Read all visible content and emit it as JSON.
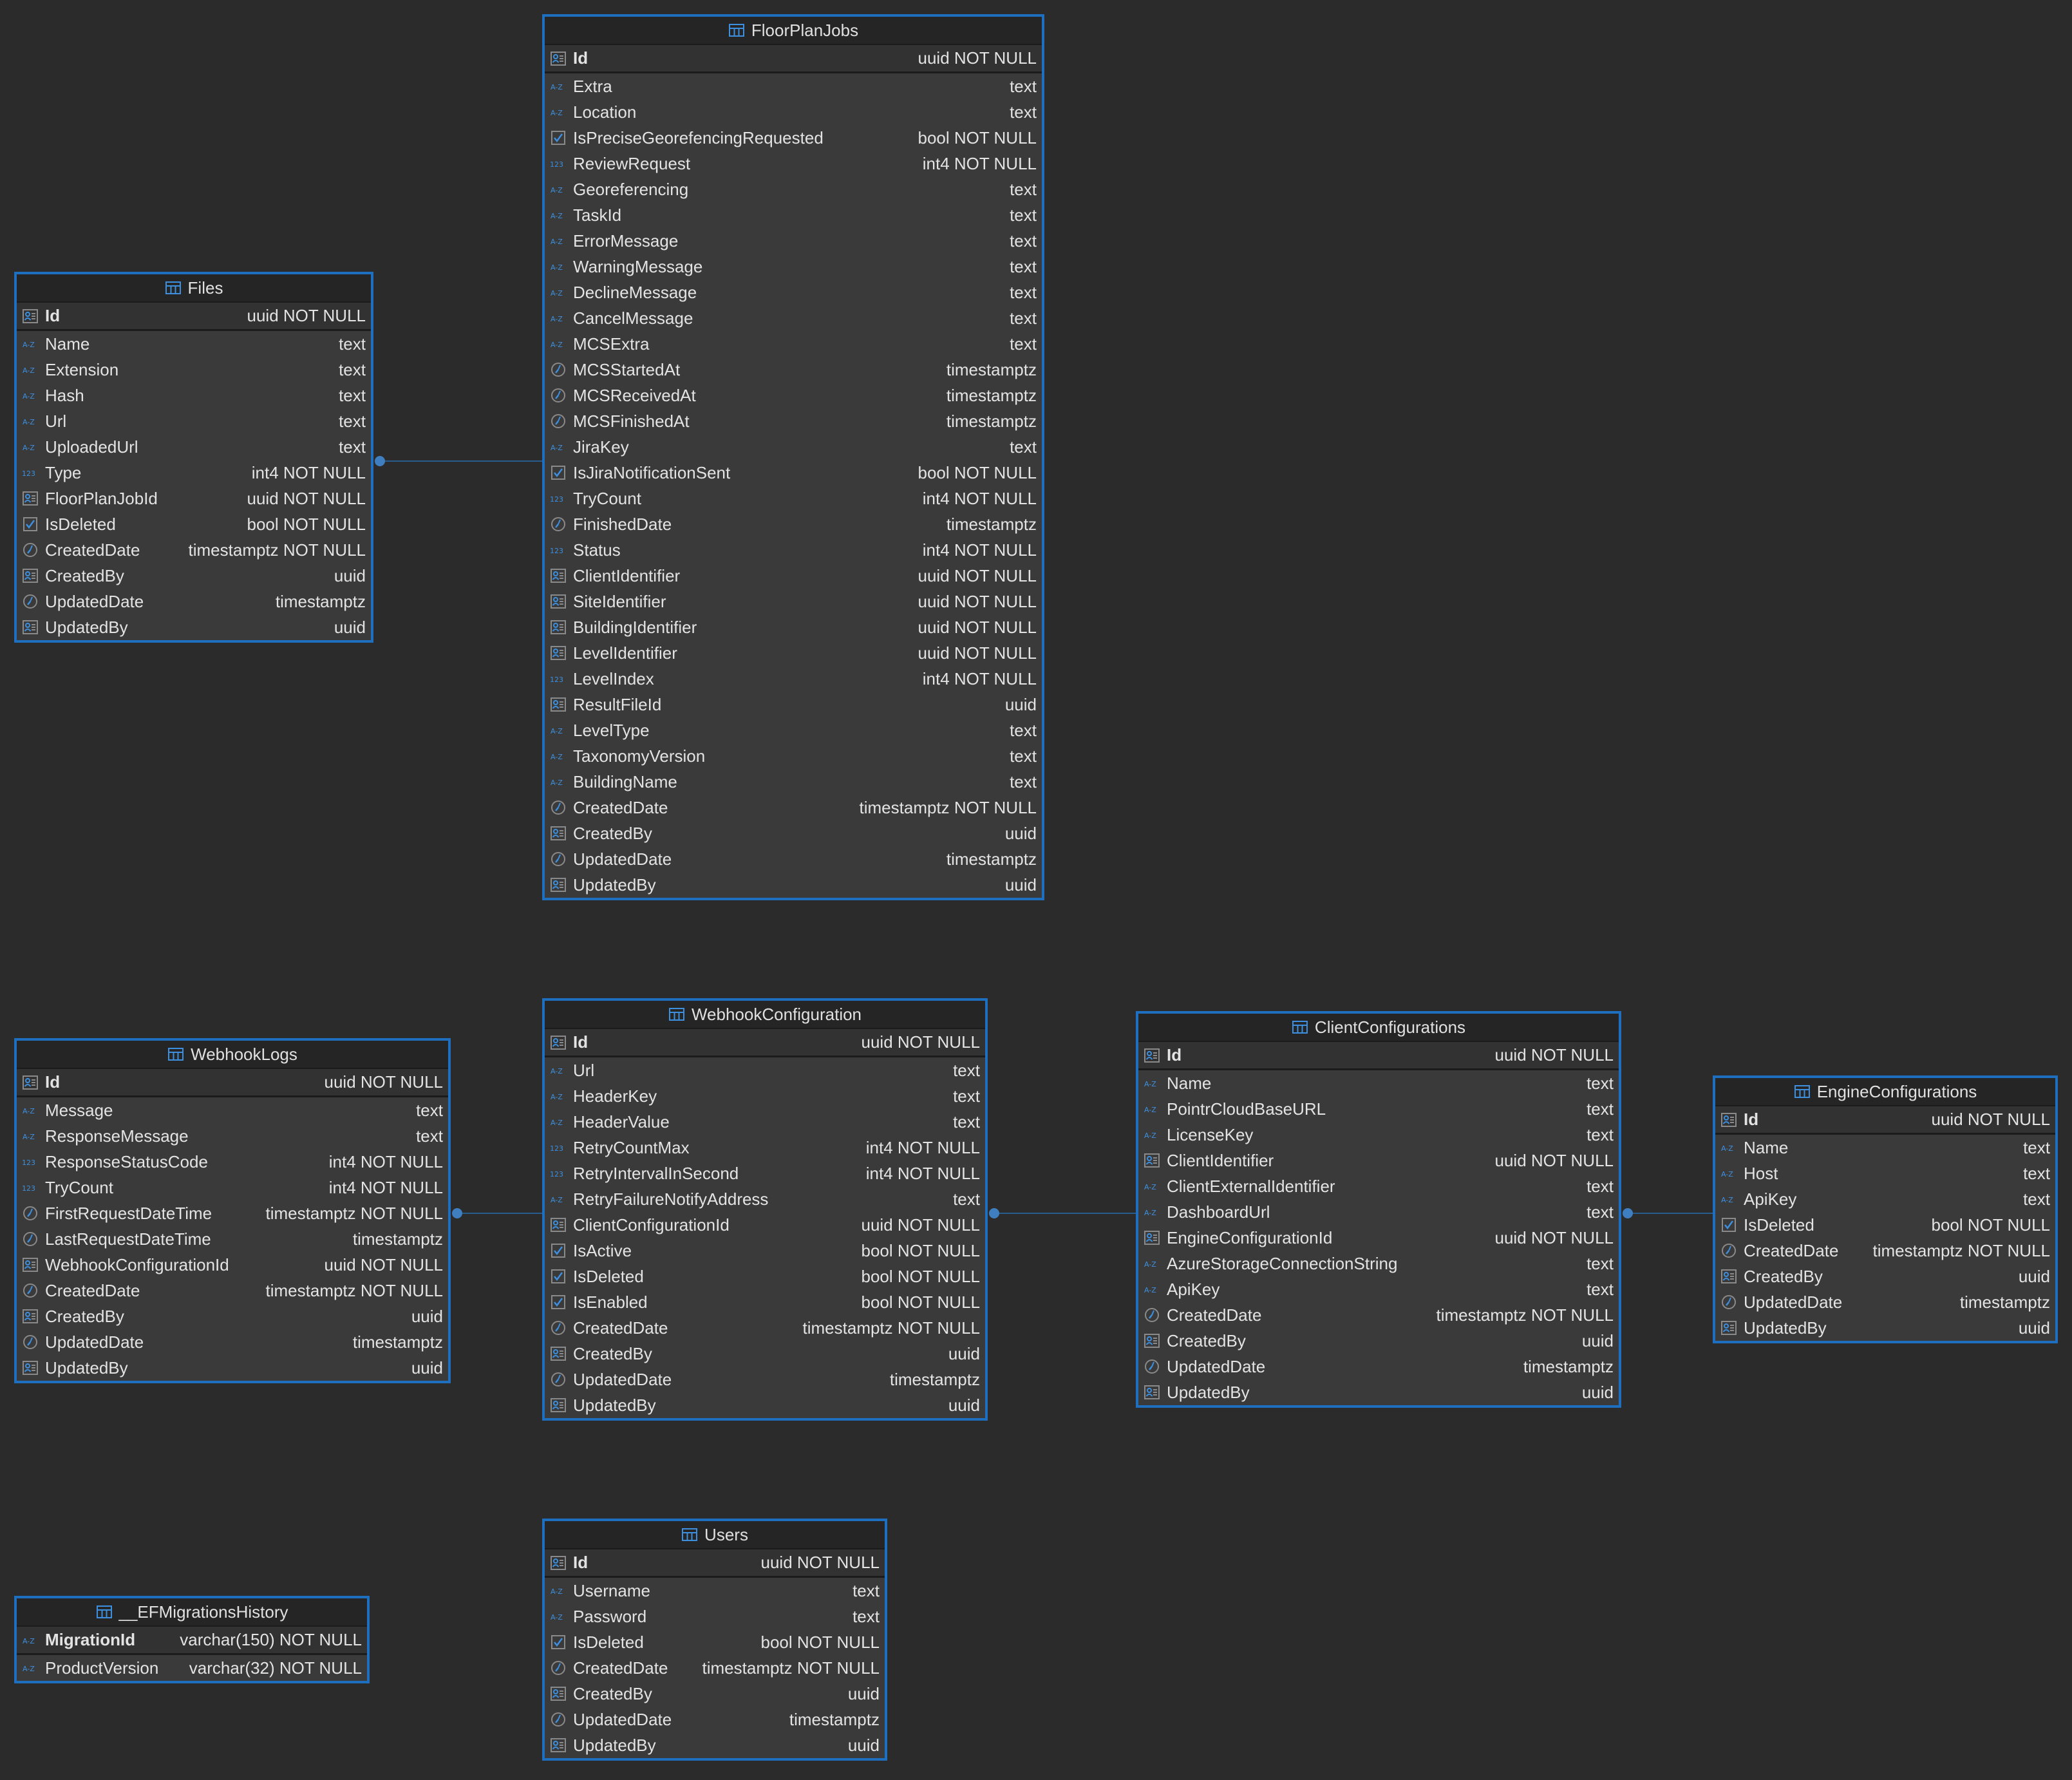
{
  "colors": {
    "background": "#2b2b2b",
    "table_border": "#1f6fc0",
    "icon_accent": "#3d8fe0",
    "link_line": "#2a5d8f"
  },
  "icons": {
    "table": "table-icon",
    "id": "id-card-icon",
    "text": "az-text-icon",
    "number": "123-number-icon",
    "boolean": "checkbox-icon",
    "datetime": "clock-icon"
  },
  "tables": [
    {
      "name": "FloorPlanJobs",
      "columns": [
        {
          "name": "Id",
          "type": "uuid NOT NULL",
          "icon": "id",
          "pk": true
        },
        {
          "name": "Extra",
          "type": "text",
          "icon": "text"
        },
        {
          "name": "Location",
          "type": "text",
          "icon": "text"
        },
        {
          "name": "IsPreciseGeorefencingRequested",
          "type": "bool NOT NULL",
          "icon": "bool"
        },
        {
          "name": "ReviewRequest",
          "type": "int4 NOT NULL",
          "icon": "num"
        },
        {
          "name": "Georeferencing",
          "type": "text",
          "icon": "text"
        },
        {
          "name": "TaskId",
          "type": "text",
          "icon": "text"
        },
        {
          "name": "ErrorMessage",
          "type": "text",
          "icon": "text"
        },
        {
          "name": "WarningMessage",
          "type": "text",
          "icon": "text"
        },
        {
          "name": "DeclineMessage",
          "type": "text",
          "icon": "text"
        },
        {
          "name": "CancelMessage",
          "type": "text",
          "icon": "text"
        },
        {
          "name": "MCSExtra",
          "type": "text",
          "icon": "text"
        },
        {
          "name": "MCSStartedAt",
          "type": "timestamptz",
          "icon": "time"
        },
        {
          "name": "MCSReceivedAt",
          "type": "timestamptz",
          "icon": "time"
        },
        {
          "name": "MCSFinishedAt",
          "type": "timestamptz",
          "icon": "time"
        },
        {
          "name": "JiraKey",
          "type": "text",
          "icon": "text"
        },
        {
          "name": "IsJiraNotificationSent",
          "type": "bool NOT NULL",
          "icon": "bool"
        },
        {
          "name": "TryCount",
          "type": "int4 NOT NULL",
          "icon": "num"
        },
        {
          "name": "FinishedDate",
          "type": "timestamptz",
          "icon": "time"
        },
        {
          "name": "Status",
          "type": "int4 NOT NULL",
          "icon": "num"
        },
        {
          "name": "ClientIdentifier",
          "type": "uuid NOT NULL",
          "icon": "id"
        },
        {
          "name": "SiteIdentifier",
          "type": "uuid NOT NULL",
          "icon": "id"
        },
        {
          "name": "BuildingIdentifier",
          "type": "uuid NOT NULL",
          "icon": "id"
        },
        {
          "name": "LevelIdentifier",
          "type": "uuid NOT NULL",
          "icon": "id"
        },
        {
          "name": "LevelIndex",
          "type": "int4 NOT NULL",
          "icon": "num"
        },
        {
          "name": "ResultFileId",
          "type": "uuid",
          "icon": "id"
        },
        {
          "name": "LevelType",
          "type": "text",
          "icon": "text"
        },
        {
          "name": "TaxonomyVersion",
          "type": "text",
          "icon": "text"
        },
        {
          "name": "BuildingName",
          "type": "text",
          "icon": "text"
        },
        {
          "name": "CreatedDate",
          "type": "timestamptz NOT NULL",
          "icon": "time"
        },
        {
          "name": "CreatedBy",
          "type": "uuid",
          "icon": "id"
        },
        {
          "name": "UpdatedDate",
          "type": "timestamptz",
          "icon": "time"
        },
        {
          "name": "UpdatedBy",
          "type": "uuid",
          "icon": "id"
        }
      ]
    },
    {
      "name": "Files",
      "columns": [
        {
          "name": "Id",
          "type": "uuid NOT NULL",
          "icon": "id",
          "pk": true
        },
        {
          "name": "Name",
          "type": "text",
          "icon": "text"
        },
        {
          "name": "Extension",
          "type": "text",
          "icon": "text"
        },
        {
          "name": "Hash",
          "type": "text",
          "icon": "text"
        },
        {
          "name": "Url",
          "type": "text",
          "icon": "text"
        },
        {
          "name": "UploadedUrl",
          "type": "text",
          "icon": "text"
        },
        {
          "name": "Type",
          "type": "int4 NOT NULL",
          "icon": "num"
        },
        {
          "name": "FloorPlanJobId",
          "type": "uuid NOT NULL",
          "icon": "id"
        },
        {
          "name": "IsDeleted",
          "type": "bool NOT NULL",
          "icon": "bool"
        },
        {
          "name": "CreatedDate",
          "type": "timestamptz NOT NULL",
          "icon": "time"
        },
        {
          "name": "CreatedBy",
          "type": "uuid",
          "icon": "id"
        },
        {
          "name": "UpdatedDate",
          "type": "timestamptz",
          "icon": "time"
        },
        {
          "name": "UpdatedBy",
          "type": "uuid",
          "icon": "id"
        }
      ]
    },
    {
      "name": "WebhookLogs",
      "columns": [
        {
          "name": "Id",
          "type": "uuid NOT NULL",
          "icon": "id",
          "pk": true
        },
        {
          "name": "Message",
          "type": "text",
          "icon": "text"
        },
        {
          "name": "ResponseMessage",
          "type": "text",
          "icon": "text"
        },
        {
          "name": "ResponseStatusCode",
          "type": "int4 NOT NULL",
          "icon": "num"
        },
        {
          "name": "TryCount",
          "type": "int4 NOT NULL",
          "icon": "num"
        },
        {
          "name": "FirstRequestDateTime",
          "type": "timestamptz NOT NULL",
          "icon": "time"
        },
        {
          "name": "LastRequestDateTime",
          "type": "timestamptz",
          "icon": "time"
        },
        {
          "name": "WebhookConfigurationId",
          "type": "uuid NOT NULL",
          "icon": "id"
        },
        {
          "name": "CreatedDate",
          "type": "timestamptz NOT NULL",
          "icon": "time"
        },
        {
          "name": "CreatedBy",
          "type": "uuid",
          "icon": "id"
        },
        {
          "name": "UpdatedDate",
          "type": "timestamptz",
          "icon": "time"
        },
        {
          "name": "UpdatedBy",
          "type": "uuid",
          "icon": "id"
        }
      ]
    },
    {
      "name": "WebhookConfiguration",
      "columns": [
        {
          "name": "Id",
          "type": "uuid NOT NULL",
          "icon": "id",
          "pk": true
        },
        {
          "name": "Url",
          "type": "text",
          "icon": "text"
        },
        {
          "name": "HeaderKey",
          "type": "text",
          "icon": "text"
        },
        {
          "name": "HeaderValue",
          "type": "text",
          "icon": "text"
        },
        {
          "name": "RetryCountMax",
          "type": "int4 NOT NULL",
          "icon": "num"
        },
        {
          "name": "RetryIntervalInSecond",
          "type": "int4 NOT NULL",
          "icon": "num"
        },
        {
          "name": "RetryFailureNotifyAddress",
          "type": "text",
          "icon": "text"
        },
        {
          "name": "ClientConfigurationId",
          "type": "uuid NOT NULL",
          "icon": "id"
        },
        {
          "name": "IsActive",
          "type": "bool NOT NULL",
          "icon": "bool"
        },
        {
          "name": "IsDeleted",
          "type": "bool NOT NULL",
          "icon": "bool"
        },
        {
          "name": "IsEnabled",
          "type": "bool NOT NULL",
          "icon": "bool"
        },
        {
          "name": "CreatedDate",
          "type": "timestamptz NOT NULL",
          "icon": "time"
        },
        {
          "name": "CreatedBy",
          "type": "uuid",
          "icon": "id"
        },
        {
          "name": "UpdatedDate",
          "type": "timestamptz",
          "icon": "time"
        },
        {
          "name": "UpdatedBy",
          "type": "uuid",
          "icon": "id"
        }
      ]
    },
    {
      "name": "ClientConfigurations",
      "columns": [
        {
          "name": "Id",
          "type": "uuid NOT NULL",
          "icon": "id",
          "pk": true
        },
        {
          "name": "Name",
          "type": "text",
          "icon": "text"
        },
        {
          "name": "PointrCloudBaseURL",
          "type": "text",
          "icon": "text"
        },
        {
          "name": "LicenseKey",
          "type": "text",
          "icon": "text"
        },
        {
          "name": "ClientIdentifier",
          "type": "uuid NOT NULL",
          "icon": "id"
        },
        {
          "name": "ClientExternalIdentifier",
          "type": "text",
          "icon": "text"
        },
        {
          "name": "DashboardUrl",
          "type": "text",
          "icon": "text"
        },
        {
          "name": "EngineConfigurationId",
          "type": "uuid NOT NULL",
          "icon": "id"
        },
        {
          "name": "AzureStorageConnectionString",
          "type": "text",
          "icon": "text"
        },
        {
          "name": "ApiKey",
          "type": "text",
          "icon": "text"
        },
        {
          "name": "CreatedDate",
          "type": "timestamptz NOT NULL",
          "icon": "time"
        },
        {
          "name": "CreatedBy",
          "type": "uuid",
          "icon": "id"
        },
        {
          "name": "UpdatedDate",
          "type": "timestamptz",
          "icon": "time"
        },
        {
          "name": "UpdatedBy",
          "type": "uuid",
          "icon": "id"
        }
      ]
    },
    {
      "name": "EngineConfigurations",
      "columns": [
        {
          "name": "Id",
          "type": "uuid NOT NULL",
          "icon": "id",
          "pk": true
        },
        {
          "name": "Name",
          "type": "text",
          "icon": "text"
        },
        {
          "name": "Host",
          "type": "text",
          "icon": "text"
        },
        {
          "name": "ApiKey",
          "type": "text",
          "icon": "text"
        },
        {
          "name": "IsDeleted",
          "type": "bool NOT NULL",
          "icon": "bool"
        },
        {
          "name": "CreatedDate",
          "type": "timestamptz NOT NULL",
          "icon": "time"
        },
        {
          "name": "CreatedBy",
          "type": "uuid",
          "icon": "id"
        },
        {
          "name": "UpdatedDate",
          "type": "timestamptz",
          "icon": "time"
        },
        {
          "name": "UpdatedBy",
          "type": "uuid",
          "icon": "id"
        }
      ]
    },
    {
      "name": "Users",
      "columns": [
        {
          "name": "Id",
          "type": "uuid NOT NULL",
          "icon": "id",
          "pk": true
        },
        {
          "name": "Username",
          "type": "text",
          "icon": "text"
        },
        {
          "name": "Password",
          "type": "text",
          "icon": "text"
        },
        {
          "name": "IsDeleted",
          "type": "bool NOT NULL",
          "icon": "bool"
        },
        {
          "name": "CreatedDate",
          "type": "timestamptz NOT NULL",
          "icon": "time"
        },
        {
          "name": "CreatedBy",
          "type": "uuid",
          "icon": "id"
        },
        {
          "name": "UpdatedDate",
          "type": "timestamptz",
          "icon": "time"
        },
        {
          "name": "UpdatedBy",
          "type": "uuid",
          "icon": "id"
        }
      ]
    },
    {
      "name": "__EFMigrationsHistory",
      "columns": [
        {
          "name": "MigrationId",
          "type": "varchar(150) NOT NULL",
          "icon": "text",
          "pk": true
        },
        {
          "name": "ProductVersion",
          "type": "varchar(32) NOT NULL",
          "icon": "text"
        }
      ]
    }
  ],
  "relationships": [
    {
      "from": "Files",
      "to": "FloorPlanJobs"
    },
    {
      "from": "WebhookLogs",
      "to": "WebhookConfiguration"
    },
    {
      "from": "WebhookConfiguration",
      "to": "ClientConfigurations"
    },
    {
      "from": "ClientConfigurations",
      "to": "EngineConfigurations"
    }
  ]
}
